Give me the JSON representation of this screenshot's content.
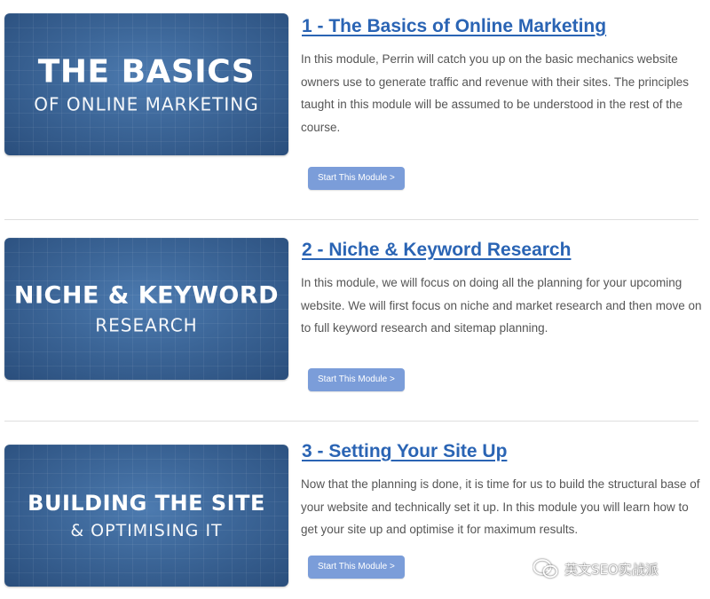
{
  "modules": [
    {
      "thumb_line1": "THE BASICS",
      "thumb_line2": "OF ONLINE MARKETING",
      "title": "1 - The Basics of Online Marketing",
      "description": "In this module, Perrin will catch you up on the basic mechanics website owners use to generate traffic and revenue with their sites. The principles taught in this module will be assumed to be understood in the rest of the course.",
      "button_label": "Start This Module >"
    },
    {
      "thumb_line1": "NICHE & KEYWORD",
      "thumb_line2": "RESEARCH",
      "title": "2 - Niche & Keyword Research",
      "description": "In this module, we will focus on doing all the planning for your upcoming website. We will first focus on niche and market research and then move on to full keyword research and sitemap planning.",
      "button_label": "Start This Module >"
    },
    {
      "thumb_line1": "BUILDING THE SITE",
      "thumb_line2": "& OPTIMISING IT",
      "title": "3 - Setting Your Site Up",
      "description": "Now that the planning is done, it is time for us to build the structural base of your website and technically set it up. In this module you will learn how to get your site up and optimise it for maximum results.",
      "button_label": "Start This Module >"
    }
  ],
  "watermark": {
    "text": "英文SEO实战派",
    "icon": "wechat-icon"
  },
  "colors": {
    "title_link": "#2a64b4",
    "button_bg": "#7b9dd9",
    "thumb_bg": "#3c6698",
    "body_text": "#555555",
    "divider": "#dedede"
  }
}
